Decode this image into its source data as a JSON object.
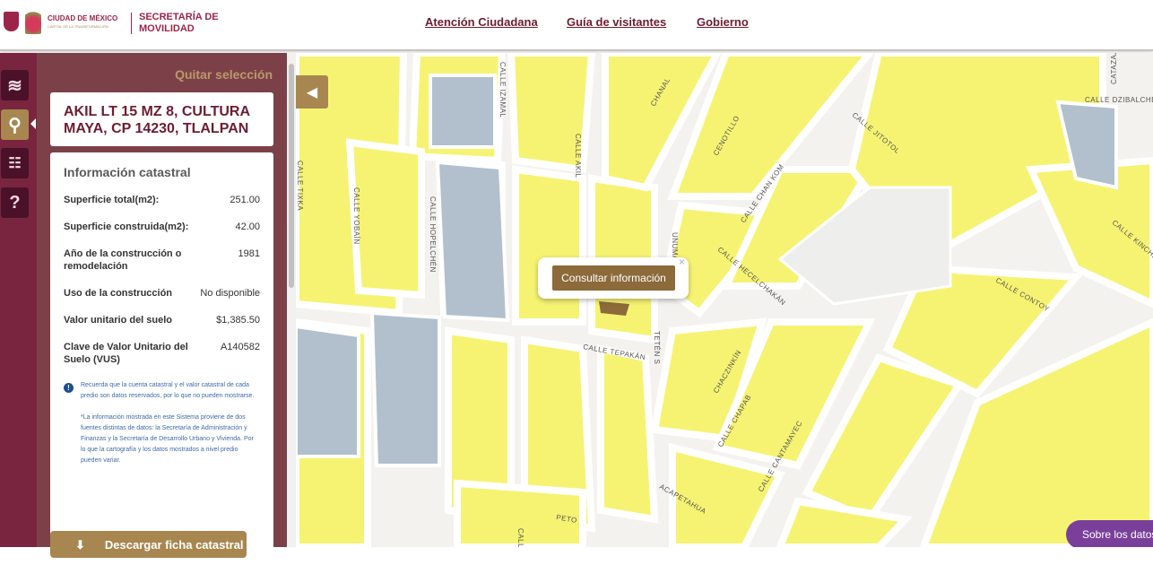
{
  "header": {
    "brand": "CIUDAD DE MÉXICO",
    "brand_sub": "CAPITAL DE LA TRANSFORMACIÓN",
    "agency": "SECRETARÍA DE MOVILIDAD",
    "nav": [
      "Atención Ciudadana",
      "Guía de visitantes",
      "Gobierno"
    ]
  },
  "rail": {
    "icons": [
      "layers-icon",
      "search-icon",
      "clipboard-icon",
      "help-icon"
    ]
  },
  "panel": {
    "clear": "Quitar selección",
    "address": "AKIL LT 15 MZ 8, CULTURA MAYA, CP 14230, TLALPAN",
    "info_title": "Información catastral",
    "rows": [
      {
        "k": "Superficie total(m2):",
        "v": "251.00"
      },
      {
        "k": "Superficie construida(m2):",
        "v": "42.00"
      },
      {
        "k": "Año de la construcción o remodelación",
        "v": "1981"
      },
      {
        "k": "Uso de la construcción",
        "v": "No disponible"
      },
      {
        "k": "Valor unitario del suelo",
        "v": "$1,385.50"
      },
      {
        "k": "Clave de Valor Unitario del Suelo (VUS)",
        "v": "A140582"
      }
    ],
    "note1": "Recuerda que la cuenta catastral y el valor catastral de cada predio son datos reservados, por lo que no pueden mostrarse.",
    "note2": "*La información mostrada en este Sistema proviene de dos fuentes distintas de datos: la Secretaría de Administración y Finanzas y la Secretaría de Desarrollo Urbano y Vivienda. Por lo que la cartografía y los datos mostrados a nivel predio pueden variar.",
    "download": "Descargar ficha catastral"
  },
  "map": {
    "popup_button": "Consultar información",
    "about": "Sobre los datos",
    "streets": [
      "CALLE IZAMAL",
      "CALLE AKIL",
      "CHANAL",
      "CENOTILLO",
      "CALLE JITOTOL",
      "CALLE DZIBALCHE",
      "CATAZAJA",
      "CALLE CHAN KOM",
      "CALLE HECELCHAKÁN",
      "CALLE TIXKA",
      "CALLE YOBAÍN",
      "CALLE HOPELCHÉN",
      "CALLE TEPAKÁN",
      "CHACZINKÍN",
      "CALLE CHAPAB",
      "CALLE CANTAMAYEC",
      "ACAPETAHUA",
      "PETO",
      "CALLE IZAMAL",
      "CALLE KINCHIL",
      "CALLE CONTOY",
      "TETÉN S",
      "UNUMA"
    ]
  }
}
